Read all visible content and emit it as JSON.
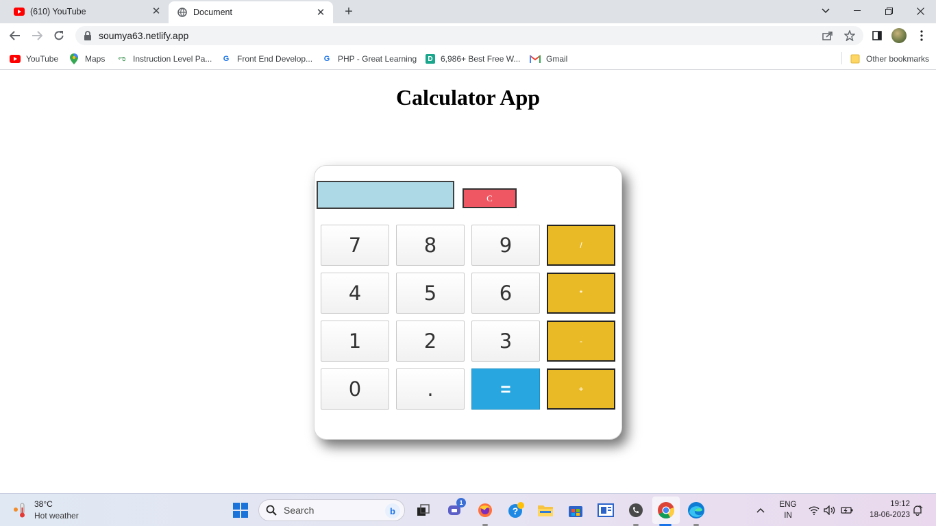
{
  "browser": {
    "tabs": [
      {
        "title": "(610) YouTube",
        "icon": "youtube-icon",
        "active": false
      },
      {
        "title": "Document",
        "icon": "globe-icon",
        "active": true
      }
    ],
    "new_tab_symbol": "+",
    "address": "soumya63.netlify.app",
    "bookmarks": [
      {
        "label": "YouTube",
        "icon": "youtube-icon"
      },
      {
        "label": "Maps",
        "icon": "maps-pin-icon"
      },
      {
        "label": "Instruction Level Pa...",
        "icon": "geeksforgeeks-icon"
      },
      {
        "label": "Front End Develop...",
        "icon": "great-learning-icon"
      },
      {
        "label": "PHP - Great Learning",
        "icon": "great-learning-icon"
      },
      {
        "label": "6,986+ Best Free W...",
        "icon": "d-site-icon"
      },
      {
        "label": "Gmail",
        "icon": "gmail-icon"
      }
    ],
    "other_bookmarks": "Other bookmarks"
  },
  "page": {
    "title": "Calculator App"
  },
  "calculator": {
    "display_value": "",
    "clear_label": "C",
    "keys": [
      [
        "7",
        "8",
        "9",
        "/"
      ],
      [
        "4",
        "5",
        "6",
        "*"
      ],
      [
        "1",
        "2",
        "3",
        "-"
      ],
      [
        "0",
        ".",
        "=",
        "+"
      ]
    ],
    "colors": {
      "display": "#add8e6",
      "clear": "#ef5763",
      "operator": "#eab926",
      "equals": "#27a6df"
    }
  },
  "taskbar": {
    "weather_temp": "38°C",
    "weather_desc": "Hot weather",
    "search_placeholder": "Search",
    "chat_badge": "1",
    "language": "ENG",
    "region": "IN",
    "time": "19:12",
    "date": "18-06-2023"
  }
}
